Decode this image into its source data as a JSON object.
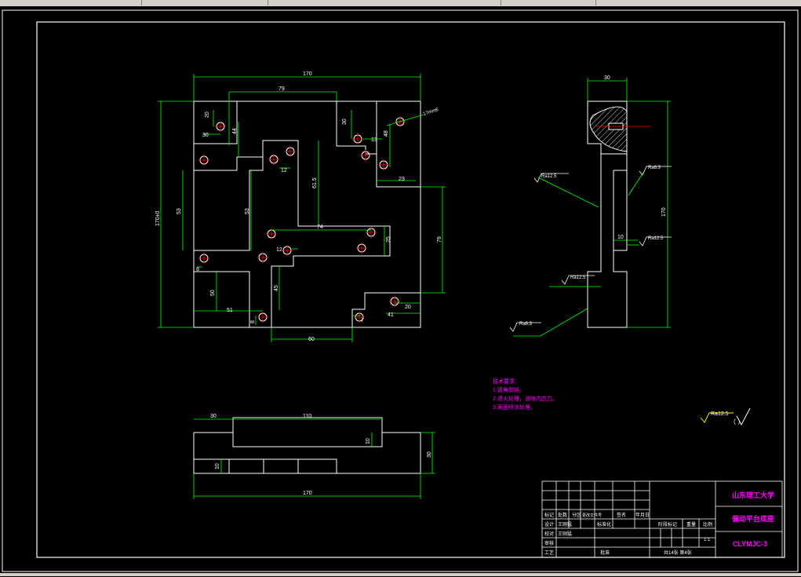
{
  "drawing": {
    "front_view": {
      "dims": {
        "overall_width": "170",
        "top_79": "79",
        "h_20": "20",
        "h_30_left": "30",
        "v_44": "44",
        "h_30_right": "30",
        "d_17mm6": "17mm6",
        "v_13": "13",
        "v_48": "48",
        "v_23": "23",
        "v_12": "12",
        "v_61_5": "61.5",
        "overall_height": "170±0",
        "v_53_left": "53",
        "v_53_mid": "53",
        "h_74": "74",
        "v_25": "25",
        "v_79": "79",
        "v_12b": "12",
        "v_8": "8",
        "v_45": "45",
        "v_50": "50",
        "h_51": "51",
        "v_8b": "8",
        "h_20b": "20",
        "v_41": "41",
        "v_7": "7",
        "h_60": "60"
      }
    },
    "side_view": {
      "dims": {
        "width_30": "30",
        "height_170": "170",
        "depth_10": "10"
      },
      "roughness": [
        "Ra12.5",
        "Ra6.3",
        "Ra12.5",
        "Ra12.5",
        "Ra6.3"
      ]
    },
    "bottom_view": {
      "dims": {
        "h_30": "30",
        "h_110": "110",
        "v_10": "10",
        "v_30": "30",
        "v_10b": "10",
        "overall": "170"
      }
    },
    "notes": {
      "title": "技术要求：",
      "lines": [
        "1.锐角倒钝。",
        "2.退火处理，消除内应力。",
        "3.表面喷涂处理。"
      ]
    },
    "general_roughness": {
      "label": "Ra12.5",
      "suffix": "（ ）"
    },
    "title_block": {
      "school": "山东理工大学",
      "part_name": "偏动平台底座",
      "code": "CLYMJC-3",
      "scale": "1:1",
      "sheets": "共14张  第4张",
      "headers": [
        "标记",
        "处数",
        "分区",
        "更改文件号",
        "签名",
        "年月日"
      ],
      "rows": [
        {
          "role": "设计",
          "name": "王刚猛",
          "mid": "标准化"
        },
        {
          "role": "校对",
          "name": "王刚猛",
          "mid": ""
        },
        {
          "role": "审核",
          "name": "",
          "mid": ""
        },
        {
          "role": "工艺",
          "name": "",
          "mid": "批准"
        }
      ],
      "stage_headers": [
        "阶段标记",
        "重量",
        "比例"
      ]
    }
  },
  "colors": {
    "line": "#ffffff",
    "dim": "#00ff00",
    "center": "#ff0000",
    "text": "#ff00ff",
    "roughness": "#ffff00"
  }
}
